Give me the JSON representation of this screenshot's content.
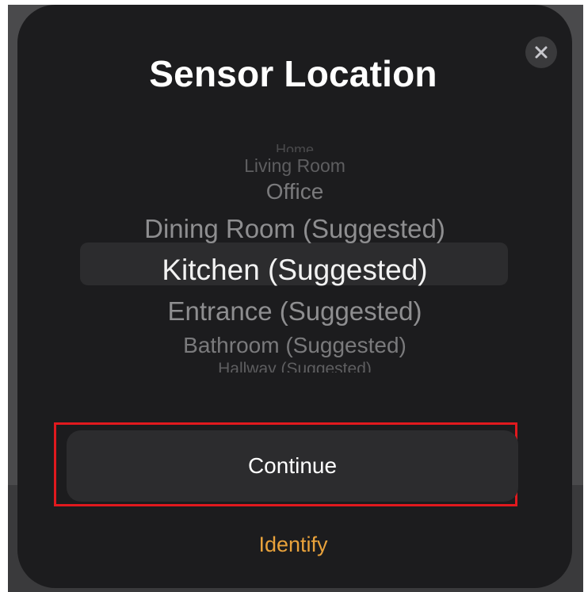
{
  "dialog": {
    "title": "Sensor Location",
    "close_icon": "close-icon",
    "primary_button_label": "Continue",
    "secondary_link_label": "Identify"
  },
  "picker": {
    "items": [
      "Home",
      "Living Room",
      "Office",
      "Dining Room (Suggested)",
      "Kitchen (Suggested)",
      "Entrance (Suggested)",
      "Bathroom (Suggested)",
      "Hallway (Suggested)"
    ],
    "selected": "Kitchen (Suggested)"
  },
  "colors": {
    "sheet_background": "#1c1c1e",
    "button_background": "#2c2c2e",
    "accent": "#e9a23b",
    "focus_outline": "#e1191e"
  }
}
